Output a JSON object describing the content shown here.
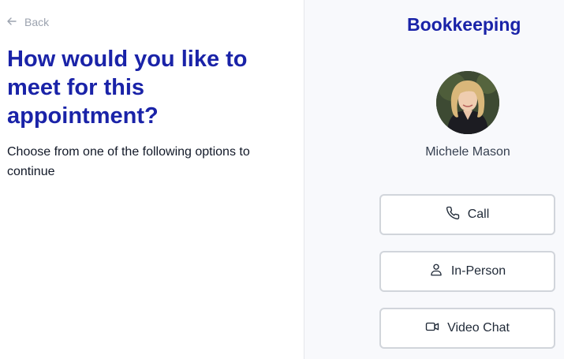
{
  "nav": {
    "back_label": "Back"
  },
  "main": {
    "heading": "How would you like to meet for this appointment?",
    "subtext": "Choose from one of the following options to continue"
  },
  "sidebar": {
    "service_title": "Bookkeeping",
    "provider_name": "Michele Mason",
    "options": [
      {
        "label": "Call",
        "icon": "phone-icon"
      },
      {
        "label": "In-Person",
        "icon": "user-icon"
      },
      {
        "label": "Video Chat",
        "icon": "video-icon"
      }
    ]
  },
  "colors": {
    "accent": "#1a23a8",
    "panel_bg": "#f8f9fc",
    "button_border": "#d1d5db"
  }
}
